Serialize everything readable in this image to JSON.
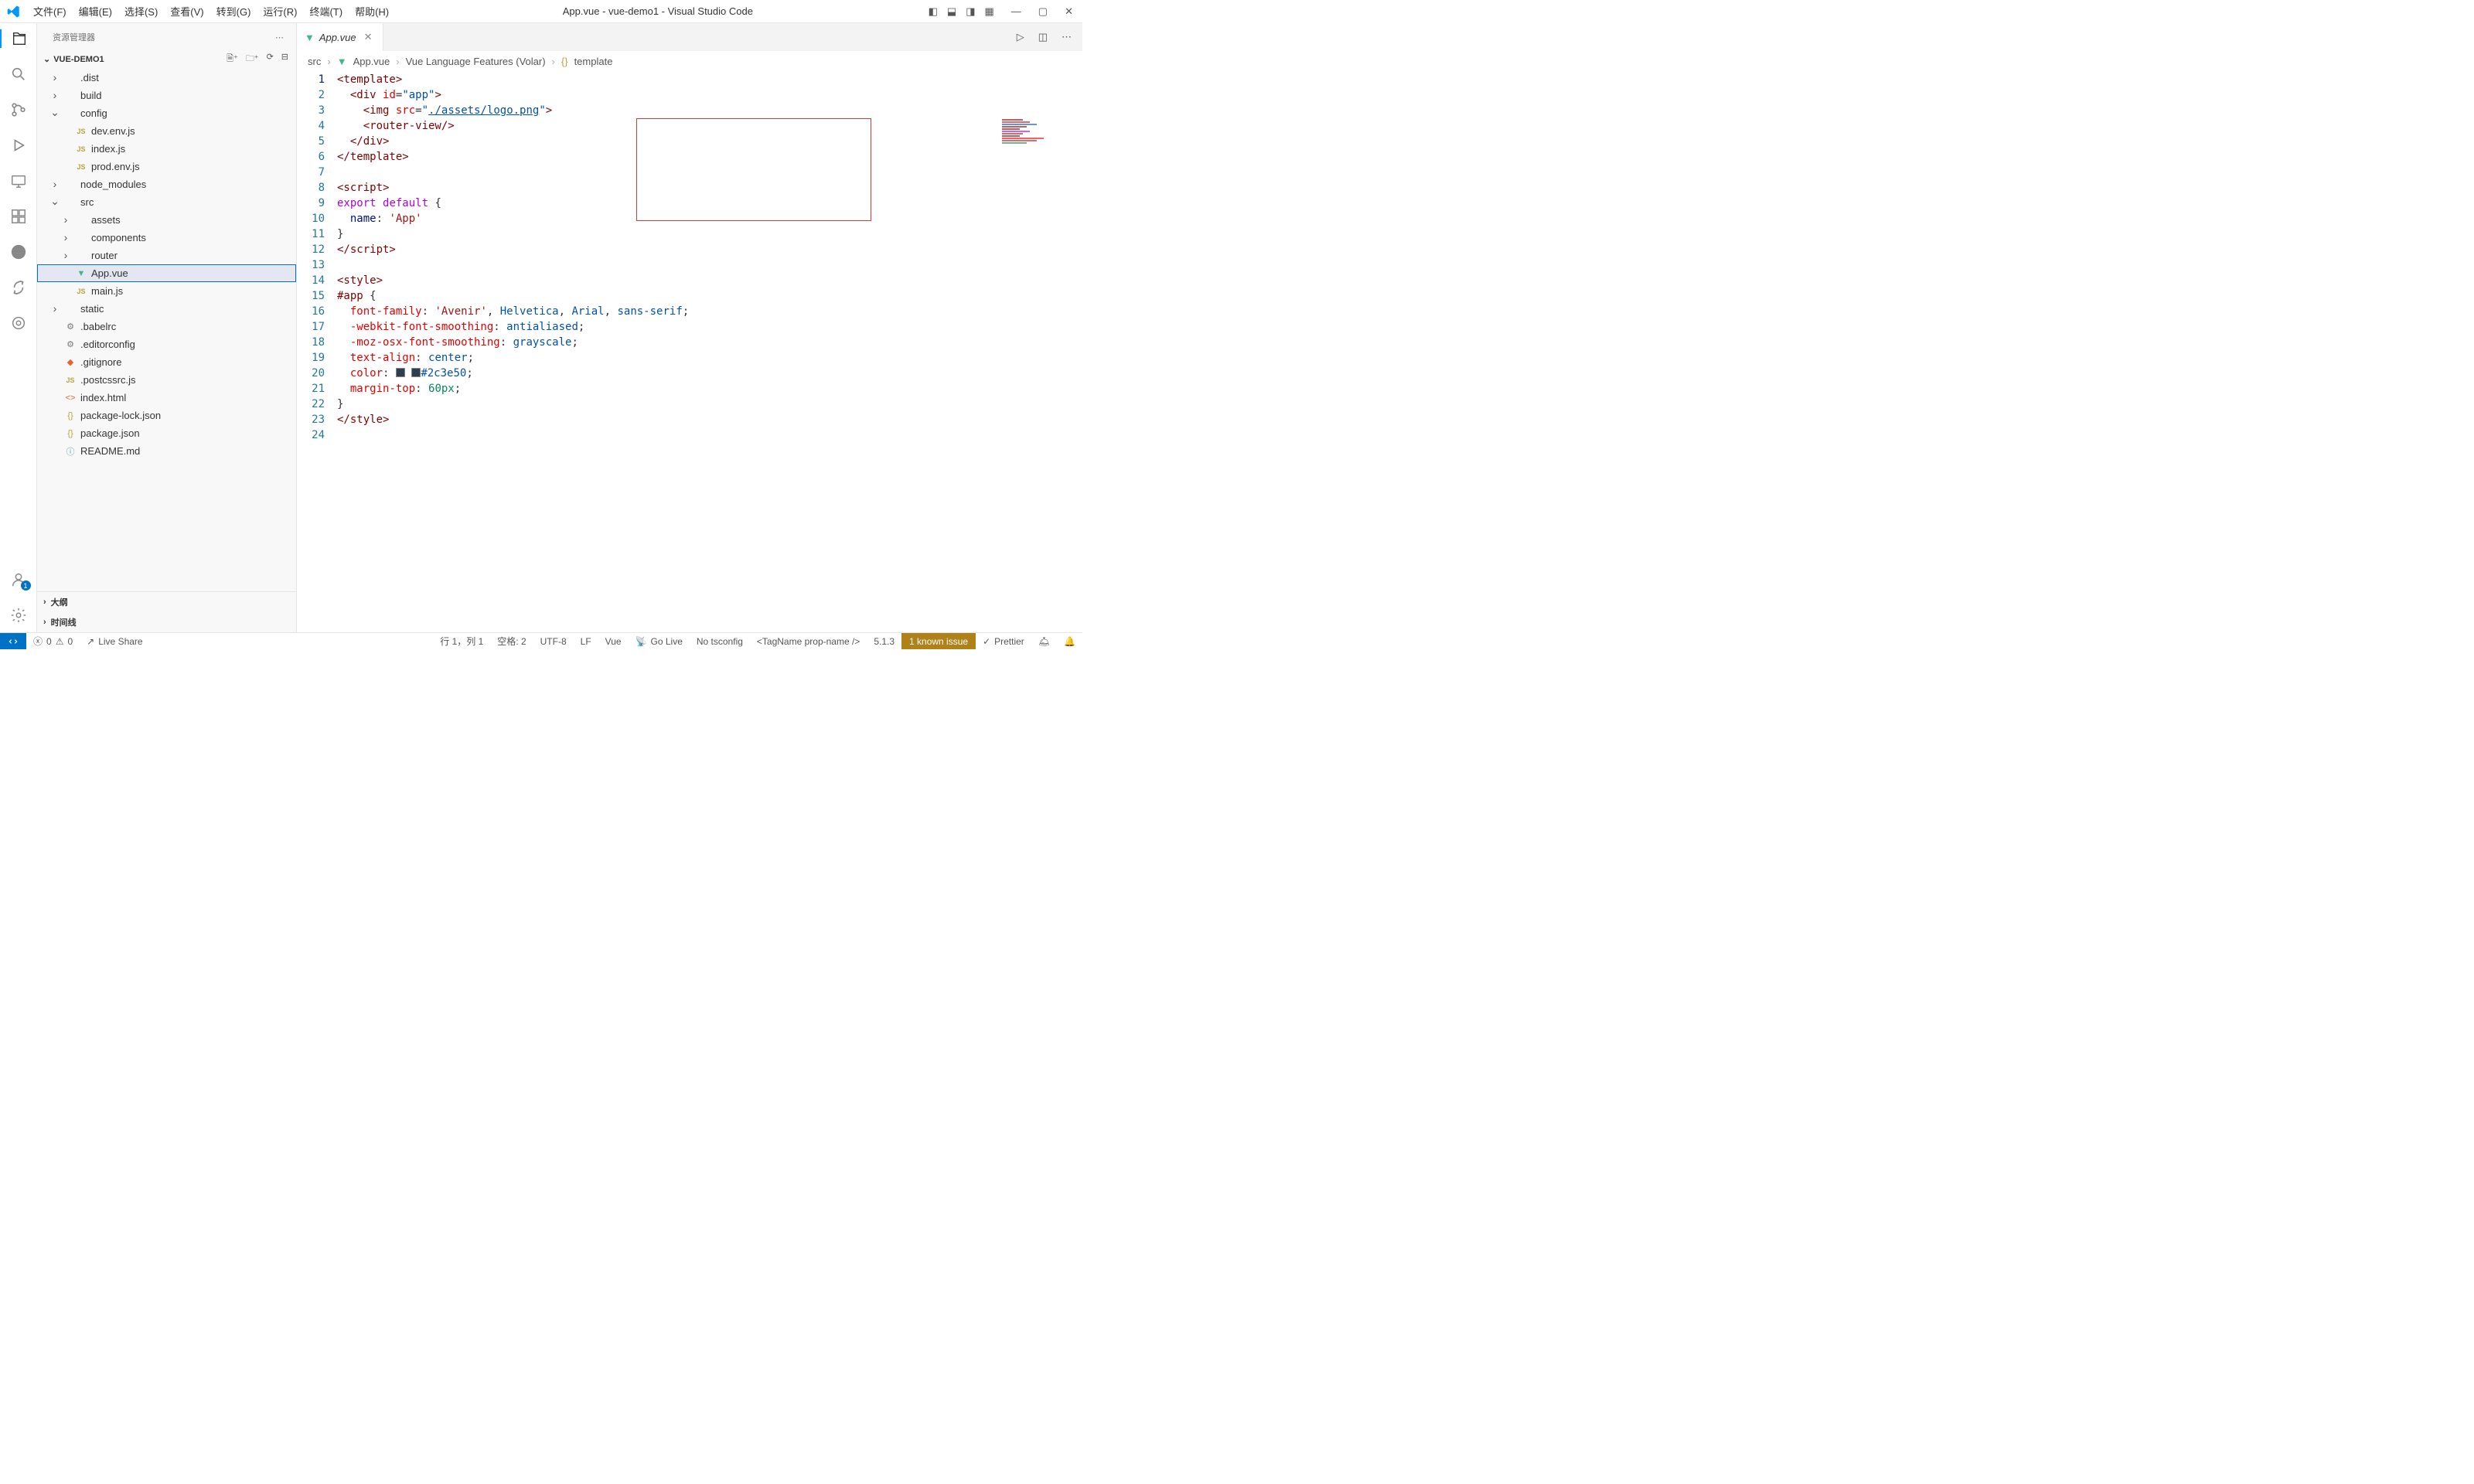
{
  "title": "App.vue - vue-demo1 - Visual Studio Code",
  "menu": [
    "文件(F)",
    "编辑(E)",
    "选择(S)",
    "查看(V)",
    "转到(G)",
    "运行(R)",
    "终端(T)",
    "帮助(H)"
  ],
  "sidebar": {
    "title": "资源管理器",
    "project": "VUE-DEMO1",
    "tree": [
      {
        "d": 0,
        "chev": "›",
        "ico": "",
        "name": ".dist"
      },
      {
        "d": 0,
        "chev": "›",
        "ico": "",
        "name": "build"
      },
      {
        "d": 0,
        "chev": "⌄",
        "ico": "",
        "name": "config"
      },
      {
        "d": 1,
        "chev": "",
        "ico": "js",
        "name": "dev.env.js"
      },
      {
        "d": 1,
        "chev": "",
        "ico": "js",
        "name": "index.js"
      },
      {
        "d": 1,
        "chev": "",
        "ico": "js",
        "name": "prod.env.js"
      },
      {
        "d": 0,
        "chev": "›",
        "ico": "",
        "name": "node_modules"
      },
      {
        "d": 0,
        "chev": "⌄",
        "ico": "",
        "name": "src"
      },
      {
        "d": 1,
        "chev": "›",
        "ico": "",
        "name": "assets"
      },
      {
        "d": 1,
        "chev": "›",
        "ico": "",
        "name": "components"
      },
      {
        "d": 1,
        "chev": "›",
        "ico": "",
        "name": "router"
      },
      {
        "d": 1,
        "chev": "",
        "ico": "vue",
        "name": "App.vue",
        "sel": true
      },
      {
        "d": 1,
        "chev": "",
        "ico": "js",
        "name": "main.js"
      },
      {
        "d": 0,
        "chev": "›",
        "ico": "",
        "name": "static"
      },
      {
        "d": 0,
        "chev": "",
        "ico": "cfg",
        "name": ".babelrc"
      },
      {
        "d": 0,
        "chev": "",
        "ico": "cfg",
        "name": ".editorconfig"
      },
      {
        "d": 0,
        "chev": "",
        "ico": "git",
        "name": ".gitignore"
      },
      {
        "d": 0,
        "chev": "",
        "ico": "js",
        "name": ".postcssrc.js"
      },
      {
        "d": 0,
        "chev": "",
        "ico": "html",
        "name": "index.html"
      },
      {
        "d": 0,
        "chev": "",
        "ico": "json",
        "name": "package-lock.json"
      },
      {
        "d": 0,
        "chev": "",
        "ico": "json",
        "name": "package.json"
      },
      {
        "d": 0,
        "chev": "",
        "ico": "md",
        "name": "README.md"
      }
    ],
    "outline": "大纲",
    "timeline": "时间线"
  },
  "tab": {
    "name": "App.vue"
  },
  "breadcrumb": [
    "src",
    "App.vue",
    "Vue Language Features (Volar)",
    "template"
  ],
  "code": {
    "lines": 24,
    "html": [
      "<span class='t-tag'>&lt;template&gt;</span>",
      "  <span class='t-tag'>&lt;div</span> <span class='t-attr'>id</span>=<span class='t-str'>\"app\"</span><span class='t-tag'>&gt;</span>",
      "    <span class='t-tag'>&lt;img</span> <span class='t-attr'>src</span>=<span class='t-str'>\"</span><span class='t-link'>./assets/logo.png</span><span class='t-str'>\"</span><span class='t-tag'>&gt;</span>",
      "    <span class='t-tag'>&lt;router-view/&gt;</span>",
      "  <span class='t-tag'>&lt;/div&gt;</span>",
      "<span class='t-tag'>&lt;/template&gt;</span>",
      "",
      "<span class='t-tag'>&lt;script&gt;</span>",
      "<span class='t-kw2'>export</span> <span class='t-kw2'>default</span> {",
      "  <span class='t-prop'>name</span>: <span class='t-str2'>'App'</span>",
      "}",
      "<span class='t-tag'>&lt;/script&gt;</span>",
      "",
      "<span class='t-tag'>&lt;style&gt;</span>",
      "<span class='t-sel'>#app</span> {",
      "  <span class='t-css'>font-family</span>: <span class='t-str2'>'Avenir'</span>, <span class='t-val'>Helvetica</span>, <span class='t-val'>Arial</span>, <span class='t-val'>sans-serif</span>;",
      "  <span class='t-css'>-webkit-font-smoothing</span>: <span class='t-val'>antialiased</span>;",
      "  <span class='t-css'>-moz-osx-font-smoothing</span>: <span class='t-val'>grayscale</span>;",
      "  <span class='t-css'>text-align</span>: <span class='t-val'>center</span>;",
      "  <span class='t-css'>color</span>: <span class='swatch' style='background:#2c3e50'></span> <span class='swatch' style='background:#2c3e50'></span><span class='t-val'>#2c3e50</span>;",
      "  <span class='t-css'>margin-top</span>: <span class='t-num'>60px</span>;",
      "}",
      "<span class='t-tag'>&lt;/style&gt;</span>",
      ""
    ]
  },
  "status": {
    "errors": "0",
    "warnings": "0",
    "live_share": "Live Share",
    "position": "行 1，列 1",
    "spaces": "空格: 2",
    "encoding": "UTF-8",
    "eol": "LF",
    "lang": "Vue",
    "golive": "Go Live",
    "tsconfig": "No tsconfig",
    "tagname": "<TagName prop-name />",
    "version": "5.1.3",
    "issue": "1 known issue",
    "prettier": "Prettier"
  }
}
